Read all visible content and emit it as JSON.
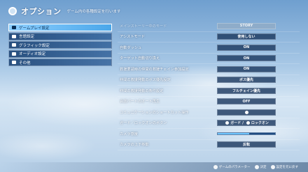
{
  "header": {
    "title": "オプション",
    "subtitle": "ゲーム内の各種設定を行います"
  },
  "sidebar": {
    "items": [
      {
        "label": "ゲームプレイ設定",
        "active": true
      },
      {
        "label": "言語設定",
        "active": false
      },
      {
        "label": "グラフィック設定",
        "active": false
      },
      {
        "label": "オーディオ設定",
        "active": false
      },
      {
        "label": "その他",
        "active": false
      }
    ]
  },
  "settings": [
    {
      "label": "メインストーリー中のモード",
      "value": "STORY",
      "dim": true
    },
    {
      "label": "アシストモード",
      "value": "使用しない"
    },
    {
      "label": "自動ダッシュ",
      "value": "ON"
    },
    {
      "label": "ターゲット自動切り換え",
      "value": "ON"
    },
    {
      "label": "救援要請時の仲間の救援チェイン参加設定",
      "value": "ON"
    },
    {
      "label": "仲間の救援発動のボス優先設定",
      "value": "ボス優先"
    },
    {
      "label": "仲間の救援発動の条件設定",
      "value": "フルチェイン優先"
    },
    {
      "label": "会話パートのオート再生",
      "value": "OFF"
    },
    {
      "label": "コミュニケーションのショートカット操作",
      "value": ""
    },
    {
      "label": "ガード／ロックオンのボタン",
      "value_left": "ガード",
      "value_sep": "/",
      "value_right": "ロックオン"
    },
    {
      "label": "カメラ感度",
      "slider": 0.55
    },
    {
      "label": "カメラの上下移動",
      "value": "反転"
    }
  ],
  "footer": {
    "hints": [
      "ゲームのパラメーター",
      "決定",
      "設定を元に戻す"
    ]
  }
}
